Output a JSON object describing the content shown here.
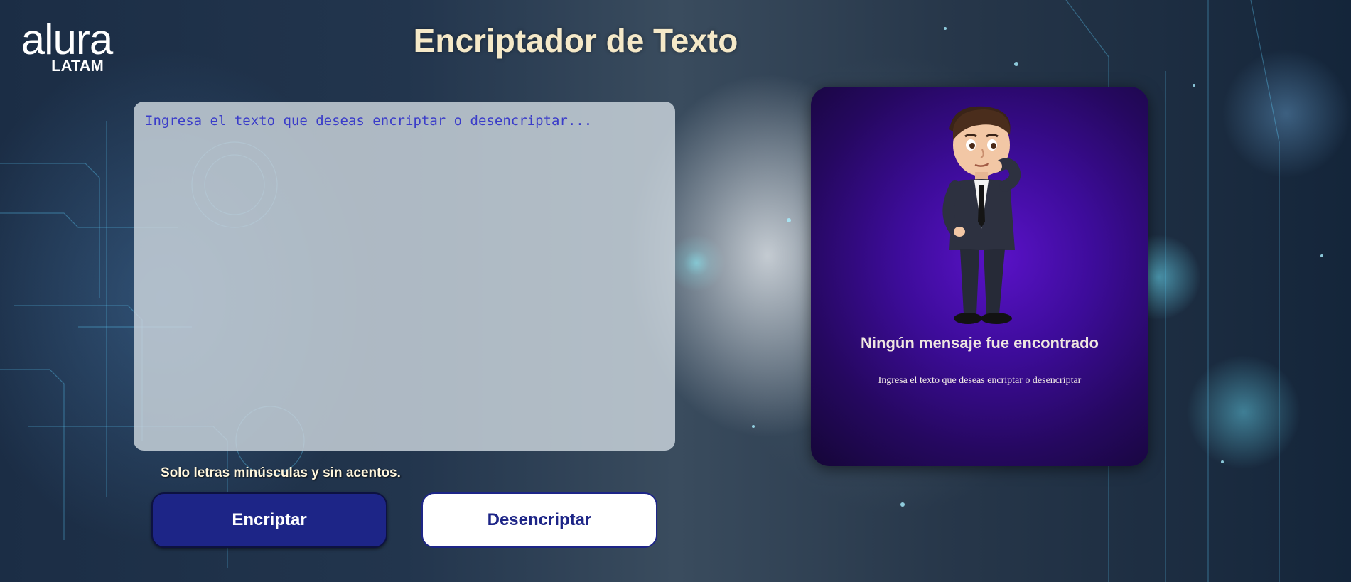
{
  "logo": {
    "main": "alura",
    "sub": "LATAM"
  },
  "header": {
    "title": "Encriptador de Texto"
  },
  "input": {
    "placeholder": "Ingresa el texto que deseas encriptar o desencriptar..."
  },
  "hint": {
    "icon": "info-icon",
    "text": "Solo letras minúsculas y sin acentos."
  },
  "buttons": {
    "encrypt_label": "Encriptar",
    "decrypt_label": "Desencriptar"
  },
  "result": {
    "title": "Ningún mensaje fue encontrado",
    "text": "Ingresa el texto que deseas encriptar o desencriptar"
  },
  "colors": {
    "title": "#f5e9c8",
    "primary_button": "#1d2587",
    "placeholder": "#3a3cc9",
    "result_card": "#3d0c9a"
  }
}
